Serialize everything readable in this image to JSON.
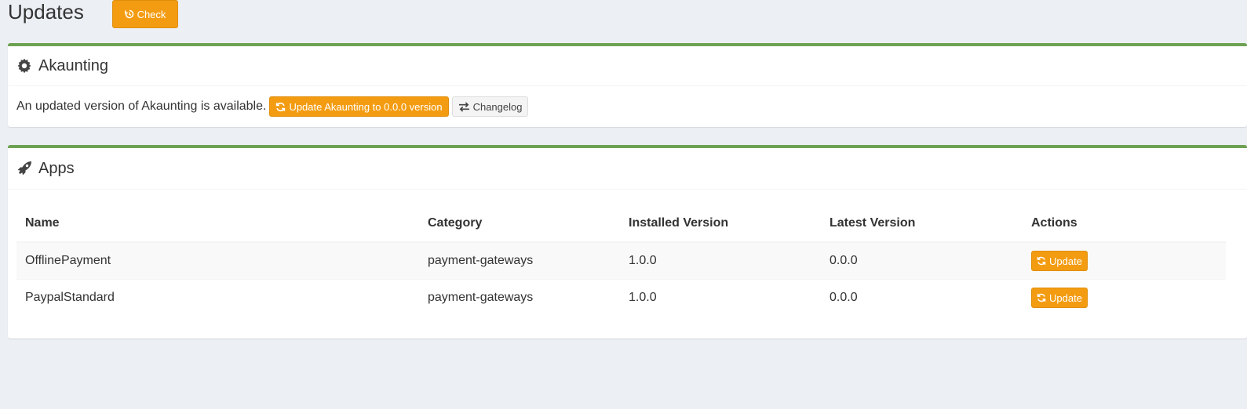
{
  "header": {
    "title": "Updates",
    "check_label": "Check"
  },
  "core": {
    "title": "Akaunting",
    "message": "An updated version of Akaunting is available.",
    "update_label": "Update Akaunting to 0.0.0 version",
    "changelog_label": "Changelog"
  },
  "apps": {
    "title": "Apps",
    "columns": [
      "Name",
      "Category",
      "Installed Version",
      "Latest Version",
      "Actions"
    ],
    "rows": [
      {
        "name": "OfflinePayment",
        "category": "payment-gateways",
        "installed": "1.0.0",
        "latest": "0.0.0",
        "action": "Update"
      },
      {
        "name": "PaypalStandard",
        "category": "payment-gateways",
        "installed": "1.0.0",
        "latest": "0.0.0",
        "action": "Update"
      }
    ]
  },
  "icons": {
    "check": "history-icon",
    "core": "gear-icon",
    "update": "refresh-icon",
    "changelog": "exchange-icon",
    "apps": "rocket-icon"
  },
  "colors": {
    "accent": "#f39c12",
    "box_border": "#6da252",
    "background": "#ecf0f5"
  }
}
